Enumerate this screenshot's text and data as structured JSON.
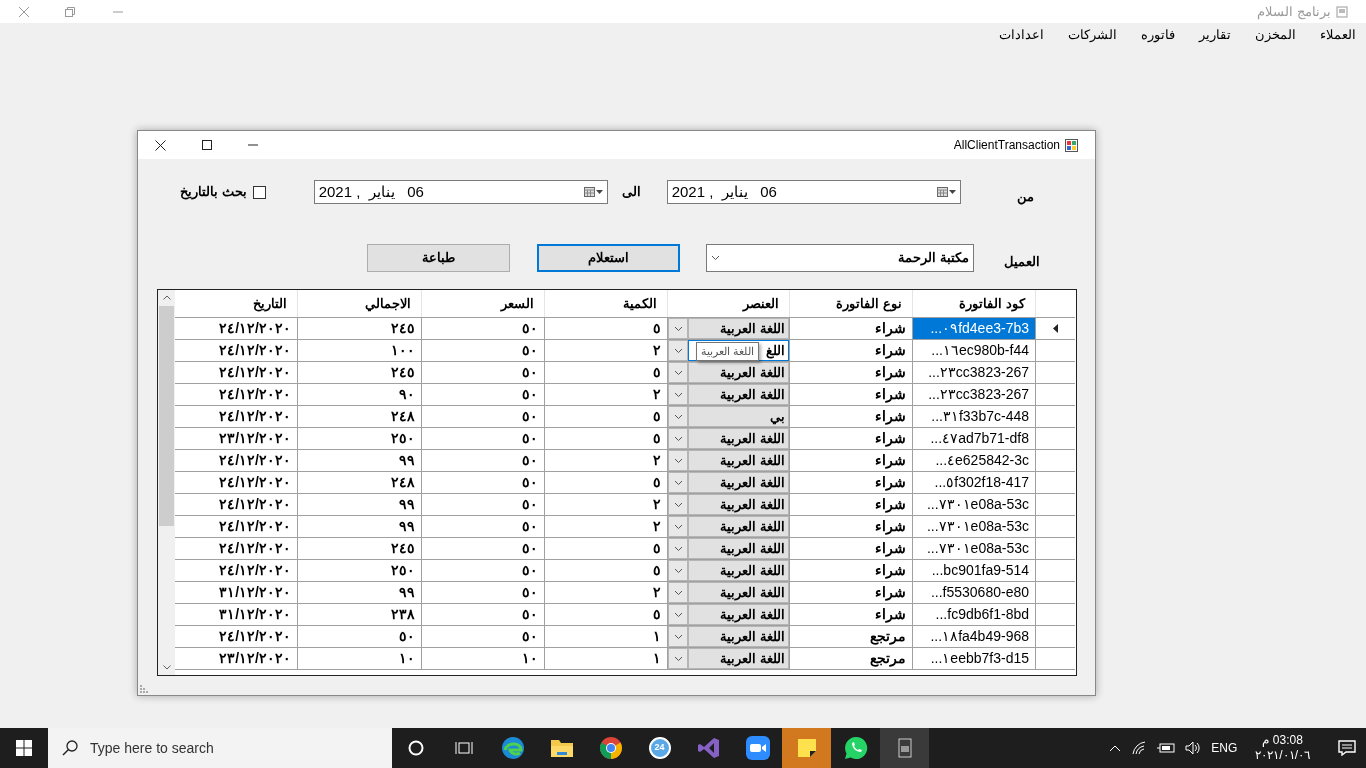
{
  "app": {
    "title": "برنامج السلام",
    "menu": [
      "العملاء",
      "المخزن",
      "تقارير",
      "فاتوره",
      "الشركات",
      "اعدادات"
    ]
  },
  "dialog": {
    "title": "AllClientTransaction",
    "from_label": "من",
    "from_date": "06   يناير  , 2021",
    "to_label": "الى",
    "to_date": "06   يناير  , 2021",
    "search_by_date": {
      "label": "بحث بالتاريخ",
      "checked": false
    },
    "client_label": "العميل",
    "client_value": "مكتبة الرحمة",
    "buttons": [
      {
        "kind": "default",
        "label": "استعلام"
      },
      {
        "kind": "normal",
        "label": "طباعة"
      }
    ],
    "table": {
      "columns": [
        "كود الفاتورة",
        "نوع الفاتورة",
        "العنصر",
        "الكمية",
        "السعر",
        "الاجمالي",
        "التاريخ"
      ],
      "tooltip": "اللغة العربية",
      "rows": [
        {
          "code": "...٠٩fd4ee3-7b3",
          "type": "شراء",
          "item": "اللغة العربية",
          "qty": "٥",
          "price": "٥٠",
          "total": "٢٤٥",
          "date": "٢٤/١٢/٢٠٢٠",
          "selected": true,
          "editing": false
        },
        {
          "code": "...١٦ec980b-f44",
          "type": "شراء",
          "item": "اللغ",
          "qty": "٢",
          "price": "٥٠",
          "total": "١٠٠",
          "date": "٢٤/١٢/٢٠٢٠",
          "selected": false,
          "editing": true
        },
        {
          "code": "...٢٣cc3823-267",
          "type": "شراء",
          "item": "اللغة العربية",
          "qty": "٥",
          "price": "٥٠",
          "total": "٢٤٥",
          "date": "٢٤/١٢/٢٠٢٠",
          "selected": false,
          "editing": false
        },
        {
          "code": "...٢٣cc3823-267",
          "type": "شراء",
          "item": "اللغة العربية",
          "qty": "٢",
          "price": "٥٠",
          "total": "٩٠",
          "date": "٢٤/١٢/٢٠٢٠",
          "selected": false,
          "editing": false
        },
        {
          "code": "...٣١f33b7c-448",
          "type": "شراء",
          "item": "بي",
          "qty": "٥",
          "price": "٥٠",
          "total": "٢٤٨",
          "date": "٢٤/١٢/٢٠٢٠",
          "selected": false,
          "editing": false
        },
        {
          "code": "...٤٧ad7b71-df8",
          "type": "شراء",
          "item": "اللغة العربية",
          "qty": "٥",
          "price": "٥٠",
          "total": "٢٥٠",
          "date": "٢٣/١٢/٢٠٢٠",
          "selected": false,
          "editing": false
        },
        {
          "code": "...٤e625842-3c",
          "type": "شراء",
          "item": "اللغة العربية",
          "qty": "٢",
          "price": "٥٠",
          "total": "٩٩",
          "date": "٢٤/١٢/٢٠٢٠",
          "selected": false,
          "editing": false
        },
        {
          "code": "...٥f302f18-417",
          "type": "شراء",
          "item": "اللغة العربية",
          "qty": "٥",
          "price": "٥٠",
          "total": "٢٤٨",
          "date": "٢٤/١٢/٢٠٢٠",
          "selected": false,
          "editing": false
        },
        {
          "code": "...٧٣٠١e08a-53c",
          "type": "شراء",
          "item": "اللغة العربية",
          "qty": "٢",
          "price": "٥٠",
          "total": "٩٩",
          "date": "٢٤/١٢/٢٠٢٠",
          "selected": false,
          "editing": false
        },
        {
          "code": "...٧٣٠١e08a-53c",
          "type": "شراء",
          "item": "اللغة العربية",
          "qty": "٢",
          "price": "٥٠",
          "total": "٩٩",
          "date": "٢٤/١٢/٢٠٢٠",
          "selected": false,
          "editing": false
        },
        {
          "code": "...٧٣٠١e08a-53c",
          "type": "شراء",
          "item": "اللغة العربية",
          "qty": "٥",
          "price": "٥٠",
          "total": "٢٤٥",
          "date": "٢٤/١٢/٢٠٢٠",
          "selected": false,
          "editing": false
        },
        {
          "code": "...bc901fa9-514",
          "type": "شراء",
          "item": "اللغة العربية",
          "qty": "٥",
          "price": "٥٠",
          "total": "٢٥٠",
          "date": "٢٤/١٢/٢٠٢٠",
          "selected": false,
          "editing": false
        },
        {
          "code": "...f5530680-e80",
          "type": "شراء",
          "item": "اللغة العربية",
          "qty": "٢",
          "price": "٥٠",
          "total": "٩٩",
          "date": "٣١/١٢/٢٠٢٠",
          "selected": false,
          "editing": false
        },
        {
          "code": "...fc9db6f1-8bd",
          "type": "شراء",
          "item": "اللغة العربية",
          "qty": "٥",
          "price": "٥٠",
          "total": "٢٣٨",
          "date": "٣١/١٢/٢٠٢٠",
          "selected": false,
          "editing": false
        },
        {
          "code": "...١٨fa4b49-968",
          "type": "مرتجع",
          "item": "اللغة العربية",
          "qty": "١",
          "price": "٥٠",
          "total": "٥٠",
          "date": "٢٤/١٢/٢٠٢٠",
          "selected": false,
          "editing": false
        },
        {
          "code": "...١eebb7f3-d15",
          "type": "مرتجع",
          "item": "اللغة العربية",
          "qty": "١",
          "price": "١٠",
          "total": "١٠",
          "date": "٢٣/١٢/٢٠٢٠",
          "selected": false,
          "editing": false
        }
      ]
    }
  },
  "taskbar": {
    "search_placeholder": "Type here to search",
    "language": "ENG",
    "time": "03:08 م",
    "date": "٢٠٢١/٠١/٠٦",
    "badge": "24"
  }
}
